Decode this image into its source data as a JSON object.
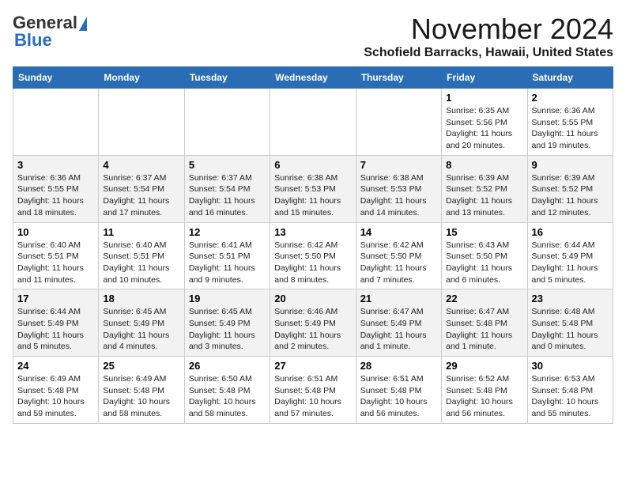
{
  "header": {
    "logo_general": "General",
    "logo_blue": "Blue",
    "month_title": "November 2024",
    "location": "Schofield Barracks, Hawaii, United States"
  },
  "weekdays": [
    "Sunday",
    "Monday",
    "Tuesday",
    "Wednesday",
    "Thursday",
    "Friday",
    "Saturday"
  ],
  "weeks": [
    [
      {
        "day": "",
        "info": ""
      },
      {
        "day": "",
        "info": ""
      },
      {
        "day": "",
        "info": ""
      },
      {
        "day": "",
        "info": ""
      },
      {
        "day": "",
        "info": ""
      },
      {
        "day": "1",
        "info": "Sunrise: 6:35 AM\nSunset: 5:56 PM\nDaylight: 11 hours and 20 minutes."
      },
      {
        "day": "2",
        "info": "Sunrise: 6:36 AM\nSunset: 5:55 PM\nDaylight: 11 hours and 19 minutes."
      }
    ],
    [
      {
        "day": "3",
        "info": "Sunrise: 6:36 AM\nSunset: 5:55 PM\nDaylight: 11 hours and 18 minutes."
      },
      {
        "day": "4",
        "info": "Sunrise: 6:37 AM\nSunset: 5:54 PM\nDaylight: 11 hours and 17 minutes."
      },
      {
        "day": "5",
        "info": "Sunrise: 6:37 AM\nSunset: 5:54 PM\nDaylight: 11 hours and 16 minutes."
      },
      {
        "day": "6",
        "info": "Sunrise: 6:38 AM\nSunset: 5:53 PM\nDaylight: 11 hours and 15 minutes."
      },
      {
        "day": "7",
        "info": "Sunrise: 6:38 AM\nSunset: 5:53 PM\nDaylight: 11 hours and 14 minutes."
      },
      {
        "day": "8",
        "info": "Sunrise: 6:39 AM\nSunset: 5:52 PM\nDaylight: 11 hours and 13 minutes."
      },
      {
        "day": "9",
        "info": "Sunrise: 6:39 AM\nSunset: 5:52 PM\nDaylight: 11 hours and 12 minutes."
      }
    ],
    [
      {
        "day": "10",
        "info": "Sunrise: 6:40 AM\nSunset: 5:51 PM\nDaylight: 11 hours and 11 minutes."
      },
      {
        "day": "11",
        "info": "Sunrise: 6:40 AM\nSunset: 5:51 PM\nDaylight: 11 hours and 10 minutes."
      },
      {
        "day": "12",
        "info": "Sunrise: 6:41 AM\nSunset: 5:51 PM\nDaylight: 11 hours and 9 minutes."
      },
      {
        "day": "13",
        "info": "Sunrise: 6:42 AM\nSunset: 5:50 PM\nDaylight: 11 hours and 8 minutes."
      },
      {
        "day": "14",
        "info": "Sunrise: 6:42 AM\nSunset: 5:50 PM\nDaylight: 11 hours and 7 minutes."
      },
      {
        "day": "15",
        "info": "Sunrise: 6:43 AM\nSunset: 5:50 PM\nDaylight: 11 hours and 6 minutes."
      },
      {
        "day": "16",
        "info": "Sunrise: 6:44 AM\nSunset: 5:49 PM\nDaylight: 11 hours and 5 minutes."
      }
    ],
    [
      {
        "day": "17",
        "info": "Sunrise: 6:44 AM\nSunset: 5:49 PM\nDaylight: 11 hours and 5 minutes."
      },
      {
        "day": "18",
        "info": "Sunrise: 6:45 AM\nSunset: 5:49 PM\nDaylight: 11 hours and 4 minutes."
      },
      {
        "day": "19",
        "info": "Sunrise: 6:45 AM\nSunset: 5:49 PM\nDaylight: 11 hours and 3 minutes."
      },
      {
        "day": "20",
        "info": "Sunrise: 6:46 AM\nSunset: 5:49 PM\nDaylight: 11 hours and 2 minutes."
      },
      {
        "day": "21",
        "info": "Sunrise: 6:47 AM\nSunset: 5:49 PM\nDaylight: 11 hours and 1 minute."
      },
      {
        "day": "22",
        "info": "Sunrise: 6:47 AM\nSunset: 5:48 PM\nDaylight: 11 hours and 1 minute."
      },
      {
        "day": "23",
        "info": "Sunrise: 6:48 AM\nSunset: 5:48 PM\nDaylight: 11 hours and 0 minutes."
      }
    ],
    [
      {
        "day": "24",
        "info": "Sunrise: 6:49 AM\nSunset: 5:48 PM\nDaylight: 10 hours and 59 minutes."
      },
      {
        "day": "25",
        "info": "Sunrise: 6:49 AM\nSunset: 5:48 PM\nDaylight: 10 hours and 58 minutes."
      },
      {
        "day": "26",
        "info": "Sunrise: 6:50 AM\nSunset: 5:48 PM\nDaylight: 10 hours and 58 minutes."
      },
      {
        "day": "27",
        "info": "Sunrise: 6:51 AM\nSunset: 5:48 PM\nDaylight: 10 hours and 57 minutes."
      },
      {
        "day": "28",
        "info": "Sunrise: 6:51 AM\nSunset: 5:48 PM\nDaylight: 10 hours and 56 minutes."
      },
      {
        "day": "29",
        "info": "Sunrise: 6:52 AM\nSunset: 5:48 PM\nDaylight: 10 hours and 56 minutes."
      },
      {
        "day": "30",
        "info": "Sunrise: 6:53 AM\nSunset: 5:48 PM\nDaylight: 10 hours and 55 minutes."
      }
    ]
  ]
}
